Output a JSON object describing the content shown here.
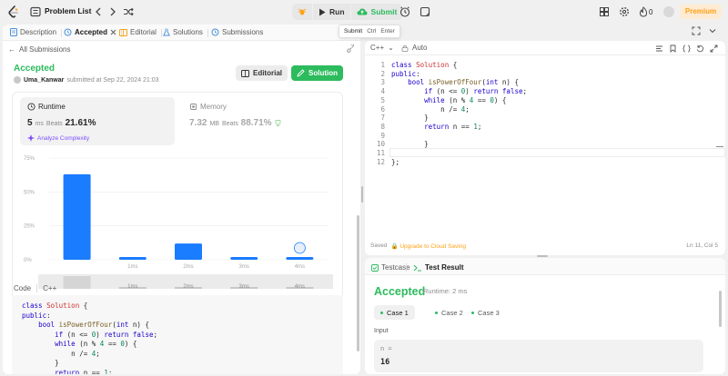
{
  "topbar": {
    "problem_list": "Problem List",
    "run": "Run",
    "submit": "Submit",
    "streak_count": "0",
    "premium": "Premium"
  },
  "tooltip": {
    "label": "Submit",
    "key1": "Ctrl",
    "key2": "Enter"
  },
  "left_tabs": {
    "description": "Description",
    "accepted": "Accepted",
    "editorial": "Editorial",
    "solutions": "Solutions",
    "submissions": "Submissions"
  },
  "submission": {
    "back": "All Submissions",
    "status": "Accepted",
    "user": "Uma_Kanwar",
    "submitted_text": "submitted at Sep 22, 2024 21:03",
    "editorial_btn": "Editorial",
    "solution_btn": "Solution"
  },
  "runtime": {
    "title": "Runtime",
    "value": "5",
    "unit": "ms",
    "beats_label": "Beats",
    "beats": "21.61%",
    "analyze": "Analyze Complexity"
  },
  "memory": {
    "title": "Memory",
    "value": "7.32",
    "unit": "MB",
    "beats_label": "Beats",
    "beats": "88.71%"
  },
  "chart_data": {
    "type": "bar",
    "y_ticks": [
      "75%",
      "50%",
      "25%",
      "0%"
    ],
    "ylim": [
      0,
      75
    ],
    "categories": [
      "",
      "1ms",
      "2ms",
      "3ms",
      "4ms"
    ],
    "values": [
      63,
      2,
      12,
      2,
      2
    ],
    "highlight_index": 0,
    "overview_labels": [
      "1ms",
      "2ms",
      "3ms",
      "4ms"
    ]
  },
  "code_section": {
    "label": "Code",
    "lang": "C++"
  },
  "editor": {
    "lang": "C++",
    "mode": "Auto",
    "saved": "Saved",
    "upgrade": "Upgrade to Cloud Saving",
    "cursor_pos": "Ln 11, Col 5",
    "line_numbers": [
      "1",
      "2",
      "3",
      "4",
      "5",
      "6",
      "7",
      "8",
      "9",
      "10",
      "11",
      "12"
    ]
  },
  "result": {
    "tab_testcase": "Testcase",
    "tab_result": "Test Result",
    "status": "Accepted",
    "runtime": "Runtime: 2 ms",
    "cases": [
      "Case 1",
      "Case 2",
      "Case 3"
    ],
    "input_label": "Input",
    "input_name": "n =",
    "input_value": "16"
  }
}
